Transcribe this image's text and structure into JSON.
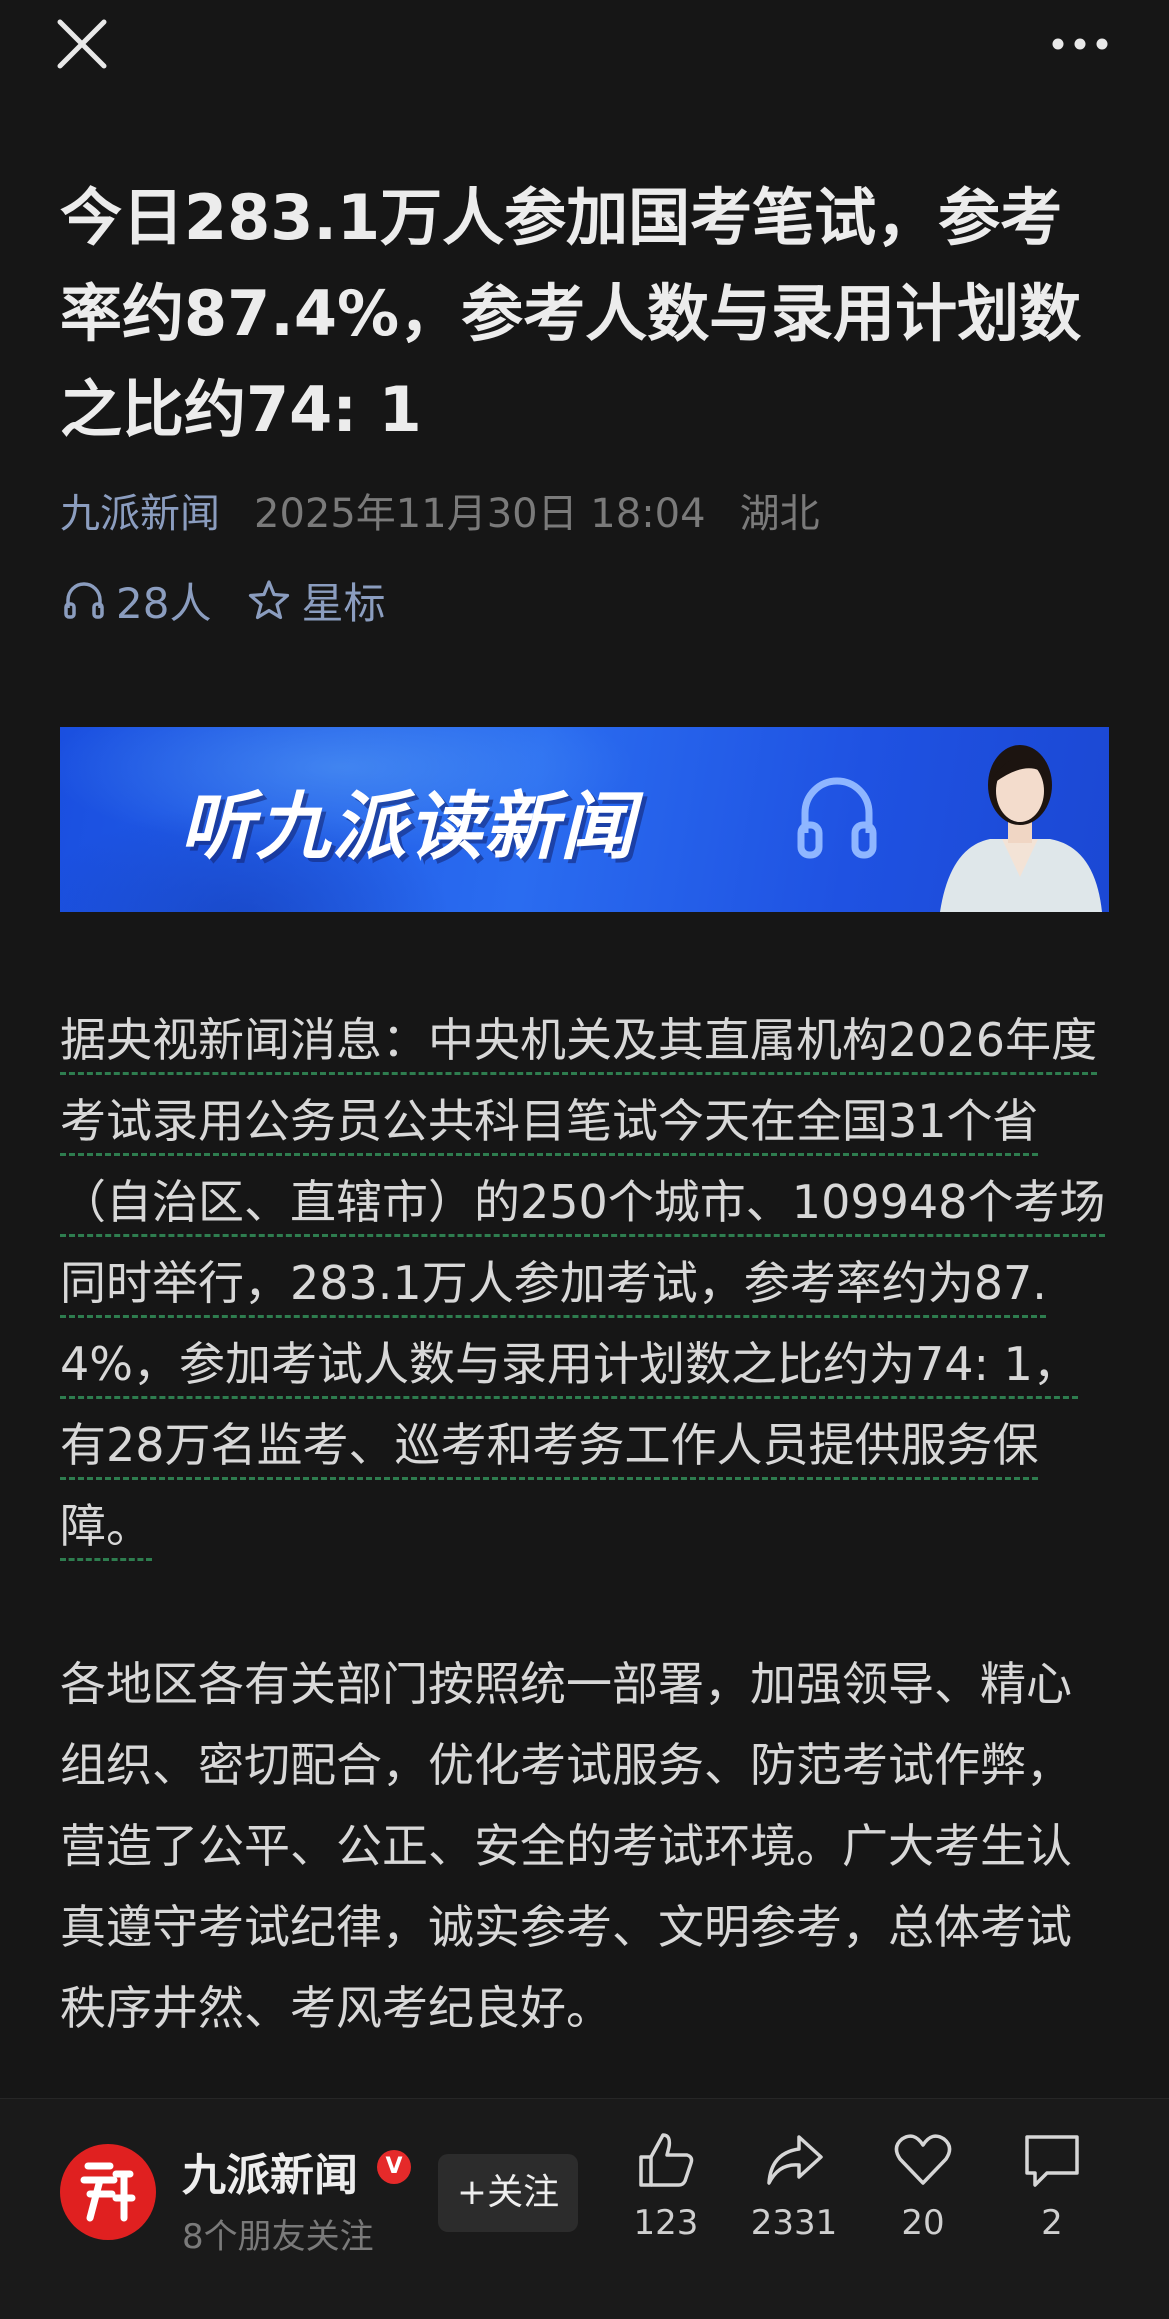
{
  "article": {
    "title": "今日283.1万人参加国考笔试，参考率约87.4%，参考人数与录用计划数之比约74: 1",
    "source": "九派新闻",
    "date": "2025年11月30日 18:04",
    "region": "湖北",
    "listeners": "28人",
    "star_label": "星标"
  },
  "banner": {
    "text": "听九派读新闻"
  },
  "body": {
    "paragraph1": "据央视新闻消息：中央机关及其直属机构2026年度考试录用公务员公共科目笔试今天在全国31个省（自治区、直辖市）的250个城市、109948个考场同时举行，283.1万人参加考试，参考率约为87.4%，参加考试人数与录用计划数之比约为74: 1，有28万名监考、巡考和考务工作人员提供服务保障。",
    "paragraph2": "各地区各有关部门按照统一部署，加强领导、精心组织、密切配合，优化考试服务、防范考试作弊，营造了公平、公正、安全的考试环境。广大考生认真遵守考试纪律，诚实参考、文明参考，总体考试秩序井然、考风考纪良好。"
  },
  "footer": {
    "account_name": "九派新闻",
    "verified_mark": "V",
    "friends_following": "8个朋友关注",
    "follow_label": "+关注",
    "likes": "123",
    "shares": "2331",
    "favorites": "20",
    "comments": "2"
  },
  "icons": {
    "close": "close-icon",
    "more": "more-icon",
    "listen": "headphones-icon",
    "star": "star-icon",
    "like": "thumbs-up-icon",
    "share": "share-icon",
    "favorite": "heart-icon",
    "comment": "comment-icon"
  },
  "colors": {
    "background": "#161616",
    "source_link": "#8b9dbf",
    "banner_blue": "#2a6cf0",
    "brand_red": "#e02020",
    "underline_green": "#2e7d4f"
  }
}
